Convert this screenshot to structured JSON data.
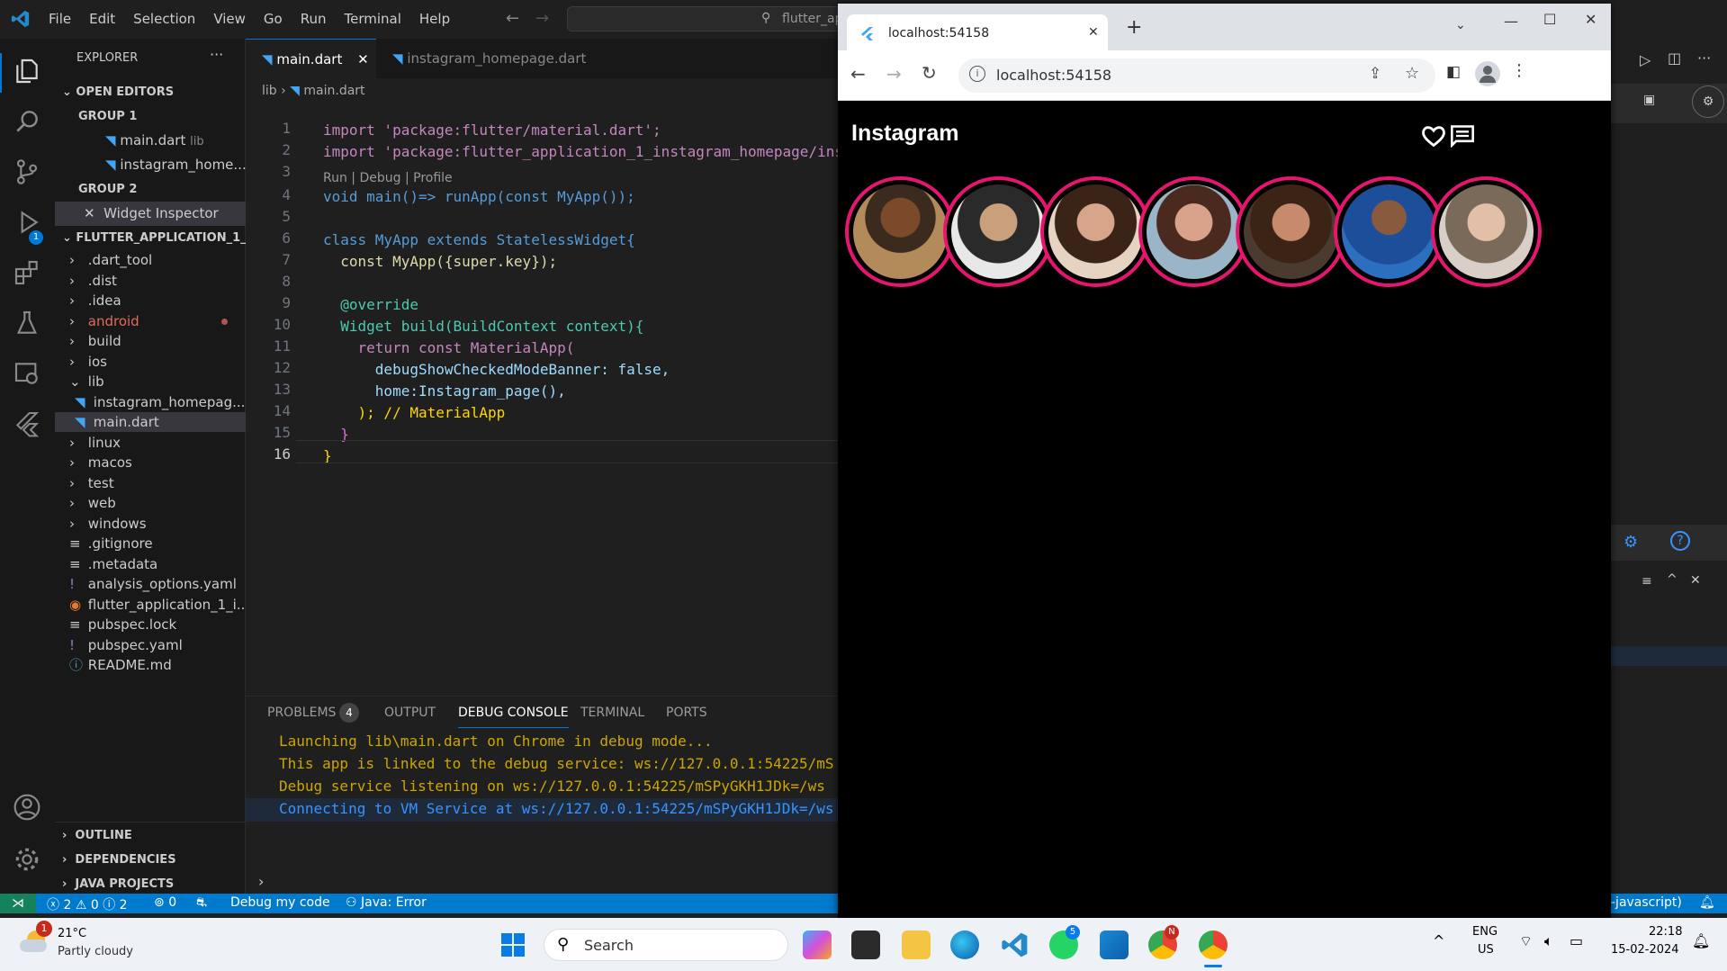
{
  "vscode": {
    "menu": [
      "File",
      "Edit",
      "Selection",
      "View",
      "Go",
      "Run",
      "Terminal",
      "Help"
    ],
    "search_text": "flutter_ap",
    "explorer": {
      "title": "EXPLORER",
      "open_editors": "OPEN EDITORS",
      "group1": "GROUP 1",
      "group1_files": [
        {
          "name": "main.dart",
          "hint": "lib"
        },
        {
          "name": "instagram_home...",
          "hint": ""
        }
      ],
      "group2": "GROUP 2",
      "group2_file": "Widget Inspector",
      "project": "FLUTTER_APPLICATION_1_I...",
      "tree": [
        {
          "name": ".dart_tool",
          "type": "folder"
        },
        {
          "name": ".dist",
          "type": "folder"
        },
        {
          "name": ".idea",
          "type": "folder"
        },
        {
          "name": "android",
          "type": "folder"
        },
        {
          "name": "build",
          "type": "folder"
        },
        {
          "name": "ios",
          "type": "folder"
        },
        {
          "name": "lib",
          "type": "folder-open"
        },
        {
          "name": "instagram_homepag...",
          "type": "dart"
        },
        {
          "name": "main.dart",
          "type": "dart"
        },
        {
          "name": "linux",
          "type": "folder"
        },
        {
          "name": "macos",
          "type": "folder"
        },
        {
          "name": "test",
          "type": "folder"
        },
        {
          "name": "web",
          "type": "folder"
        },
        {
          "name": "windows",
          "type": "folder"
        },
        {
          "name": ".gitignore",
          "type": "file"
        },
        {
          "name": ".metadata",
          "type": "file"
        },
        {
          "name": "analysis_options.yaml",
          "type": "yaml"
        },
        {
          "name": "flutter_application_1_i...",
          "type": "rss"
        },
        {
          "name": "pubspec.lock",
          "type": "file"
        },
        {
          "name": "pubspec.yaml",
          "type": "yaml"
        },
        {
          "name": "README.md",
          "type": "info"
        }
      ],
      "outline": "OUTLINE",
      "dependencies": "DEPENDENCIES",
      "java_projects": "JAVA PROJECTS"
    },
    "tabs": [
      {
        "label": "main.dart",
        "active": true
      },
      {
        "label": "instagram_homepage.dart",
        "active": false
      }
    ],
    "breadcrumb": [
      "lib",
      "main.dart"
    ],
    "codelens": "Run | Debug | Profile",
    "code_lines": [
      {
        "n": "1",
        "text": "import 'package:flutter/material.dart';"
      },
      {
        "n": "2",
        "text": "import 'package:flutter_application_1_instagram_homepage/ins"
      },
      {
        "n": "3",
        "text": ""
      },
      {
        "n": "4",
        "text": "void main()=> runApp(const MyApp());"
      },
      {
        "n": "5",
        "text": ""
      },
      {
        "n": "6",
        "text": "class MyApp extends StatelessWidget{"
      },
      {
        "n": "7",
        "text": "  const MyApp({super.key});"
      },
      {
        "n": "8",
        "text": ""
      },
      {
        "n": "9",
        "text": "  @override"
      },
      {
        "n": "10",
        "text": "  Widget build(BuildContext context){"
      },
      {
        "n": "11",
        "text": "    return const MaterialApp("
      },
      {
        "n": "12",
        "text": "      debugShowCheckedModeBanner: false,"
      },
      {
        "n": "13",
        "text": "      home:Instagram_page(),"
      },
      {
        "n": "14",
        "text": "    ); // MaterialApp"
      },
      {
        "n": "15",
        "text": "  }"
      },
      {
        "n": "16",
        "text": "}"
      }
    ],
    "panel": {
      "tabs": [
        "PROBLEMS",
        "OUTPUT",
        "DEBUG CONSOLE",
        "TERMINAL",
        "PORTS"
      ],
      "problems_count": "4",
      "lines": [
        "Launching lib\\main.dart on Chrome in debug mode...",
        "This app is linked to the debug service: ws://127.0.0.1:54225/mS",
        "Debug service listening on ws://127.0.0.1:54225/mSPyGKH1JDk=/ws",
        "Connecting to VM Service at ws://127.0.0.1:54225/mSPyGKH1JDk=/ws"
      ]
    },
    "status": {
      "errors": "2",
      "warnings": "0",
      "info": "2",
      "ports": "0",
      "debug": "Debug my code",
      "java": "Java: Error",
      "right": "-javascript)"
    }
  },
  "browser": {
    "tab_title": "localhost:54158",
    "url": "localhost:54158",
    "app_title": "Instagram",
    "story_count": 7
  },
  "taskbar": {
    "weather_temp": "21°C",
    "weather_desc": "Partly cloudy",
    "weather_badge": "1",
    "search": "Search",
    "lang1": "ENG",
    "lang2": "US",
    "time": "22:18",
    "date": "15-02-2024",
    "whatsapp_badge": "5",
    "chrome_badge": "N"
  },
  "colors": {
    "accent": "#007acc",
    "story_ring": "#e6166f"
  }
}
